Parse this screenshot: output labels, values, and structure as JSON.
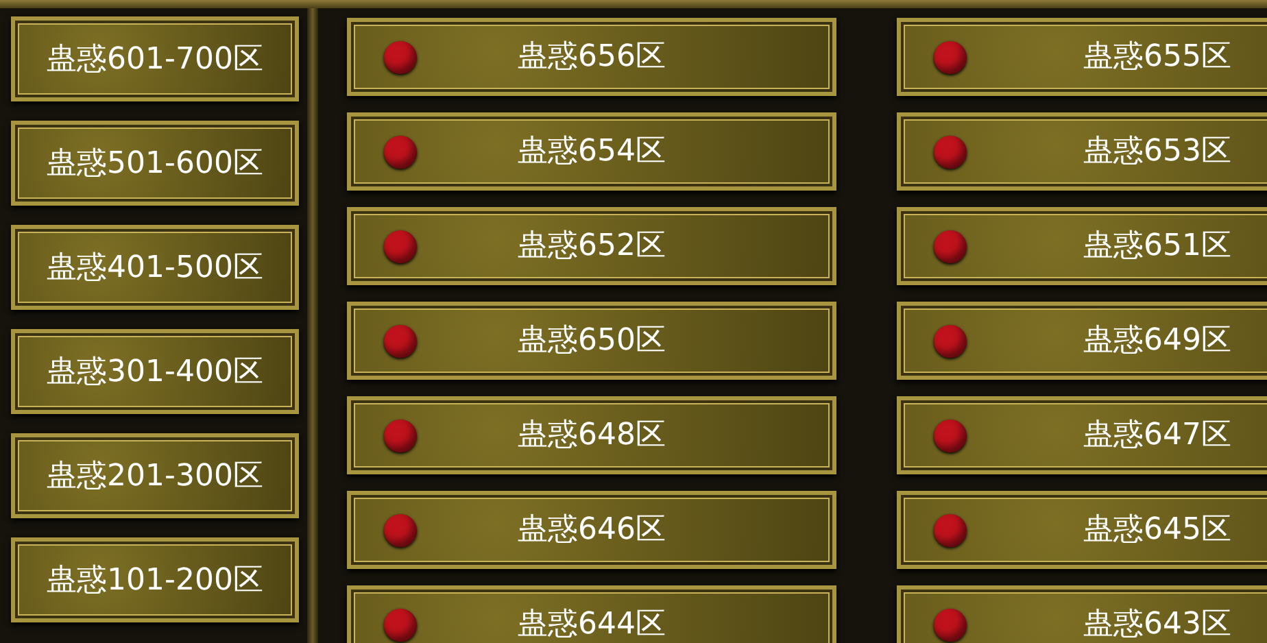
{
  "server_groups": [
    {
      "label": "蛊惑601-700区"
    },
    {
      "label": "蛊惑501-600区"
    },
    {
      "label": "蛊惑401-500区"
    },
    {
      "label": "蛊惑301-400区"
    },
    {
      "label": "蛊惑201-300区"
    },
    {
      "label": "蛊惑101-200区"
    }
  ],
  "servers": [
    {
      "label": "蛊惑656区",
      "color": "#c0121c"
    },
    {
      "label": "蛊惑655区",
      "color": "#c0121c"
    },
    {
      "label": "蛊惑654区",
      "color": "#c0121c"
    },
    {
      "label": "蛊惑653区",
      "color": "#c0121c"
    },
    {
      "label": "蛊惑652区",
      "color": "#c0121c"
    },
    {
      "label": "蛊惑651区",
      "color": "#c0121c"
    },
    {
      "label": "蛊惑650区",
      "color": "#c0121c"
    },
    {
      "label": "蛊惑649区",
      "color": "#c0121c"
    },
    {
      "label": "蛊惑648区",
      "color": "#c0121c"
    },
    {
      "label": "蛊惑647区",
      "color": "#c0121c"
    },
    {
      "label": "蛊惑646区",
      "color": "#c0121c"
    },
    {
      "label": "蛊惑645区",
      "color": "#c0121c"
    },
    {
      "label": "蛊惑644区",
      "color": "#c0121c"
    },
    {
      "label": "蛊惑643区",
      "color": "#c0121c"
    }
  ]
}
